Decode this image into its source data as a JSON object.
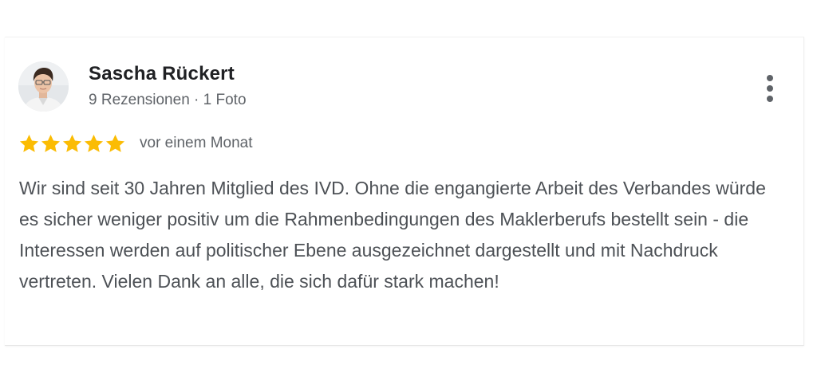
{
  "review": {
    "author": {
      "name": "Sascha Rückert",
      "meta": "9 Rezensionen · 1 Foto",
      "avatar_icon": "person-photo-avatar"
    },
    "rating": {
      "stars": 5,
      "max_stars": 5,
      "star_color": "#fbbc04"
    },
    "time": "vor einem Monat",
    "text": "Wir sind seit 30 Jahren Mitglied des IVD. Ohne die engangierte Arbeit des Verbandes würde es sicher weniger positiv um die Rahmenbedingungen des Maklerberufs bestellt sein - die Interessen werden auf politischer Ebene ausgezeichnet dargestellt und mit Nachdruck vertreten. Vielen Dank an alle, die sich dafür stark machen!",
    "more_icon": "more-vertical-icon"
  },
  "colors": {
    "name": "#202124",
    "secondary": "#5f6368",
    "body_text": "#4d5156",
    "star": "#fbbc04"
  }
}
